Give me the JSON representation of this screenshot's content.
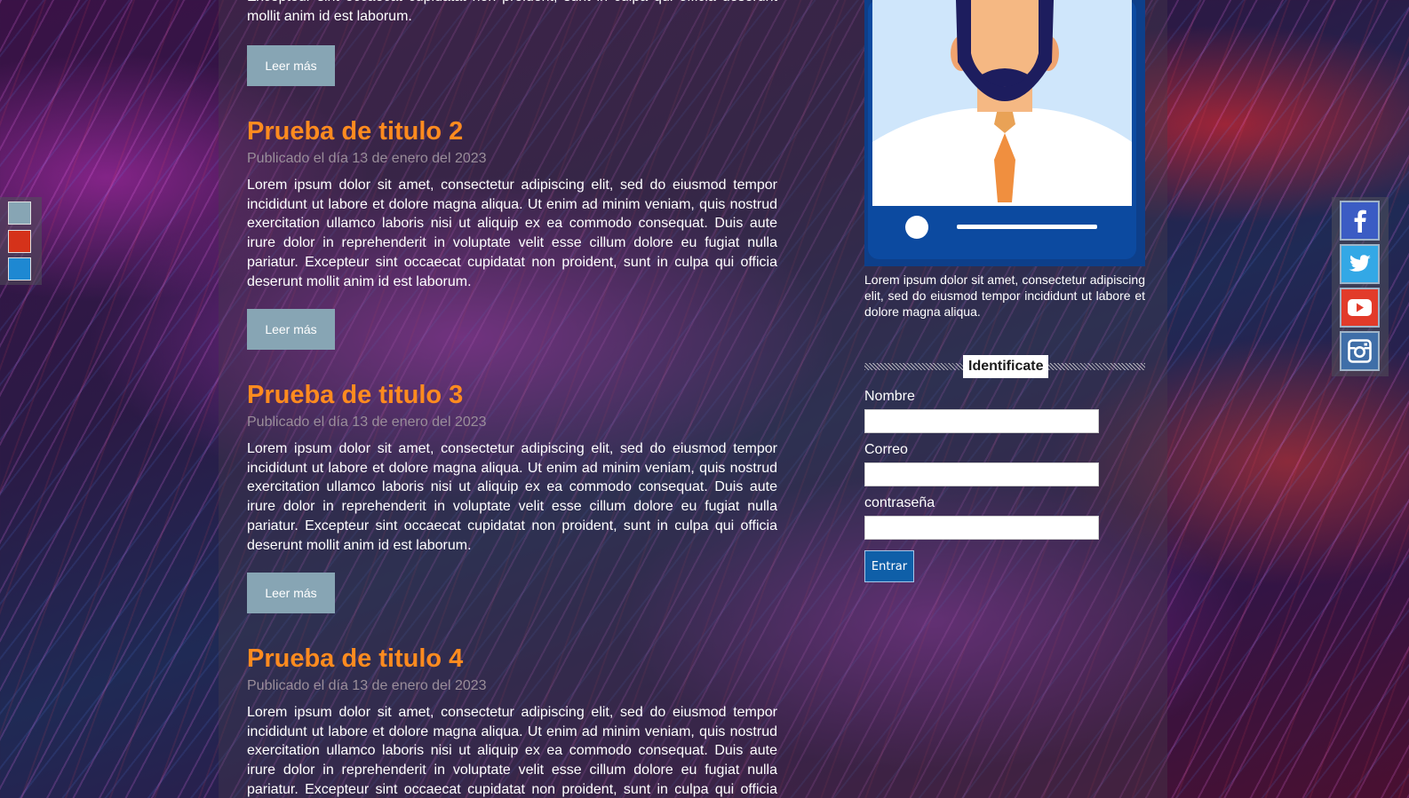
{
  "main": {
    "partial_post": {
      "body": "Excepteur sint occaecat cupidatat non proident, sunt in culpa qui officia deserunt mollit anim id est laborum.",
      "read_more": "Leer más"
    },
    "posts": [
      {
        "title": "Prueba de titulo 2",
        "date": "Publicado el día 13 de enero del 2023",
        "body": "Lorem ipsum dolor sit amet, consectetur adipiscing elit, sed do eiusmod tempor incididunt ut labore et dolore magna aliqua. Ut enim ad minim veniam, quis nostrud exercitation ullamco laboris nisi ut aliquip ex ea commodo consequat. Duis aute irure dolor in reprehenderit in voluptate velit esse cillum dolore eu fugiat nulla pariatur. Excepteur sint occaecat cupidatat non proident, sunt in culpa qui officia deserunt mollit anim id est laborum.",
        "read_more": "Leer más"
      },
      {
        "title": "Prueba de titulo 3",
        "date": "Publicado el día 13 de enero del 2023",
        "body": "Lorem ipsum dolor sit amet, consectetur adipiscing elit, sed do eiusmod tempor incididunt ut labore et dolore magna aliqua. Ut enim ad minim veniam, quis nostrud exercitation ullamco laboris nisi ut aliquip ex ea commodo consequat. Duis aute irure dolor in reprehenderit in voluptate velit esse cillum dolore eu fugiat nulla pariatur. Excepteur sint occaecat cupidatat non proident, sunt in culpa qui officia deserunt mollit anim id est laborum.",
        "read_more": "Leer más"
      },
      {
        "title": "Prueba de titulo 4",
        "date": "Publicado el día 13 de enero del 2023",
        "body": "Lorem ipsum dolor sit amet, consectetur adipiscing elit, sed do eiusmod tempor incididunt ut labore et dolore magna aliqua. Ut enim ad minim veniam, quis nostrud exercitation ullamco laboris nisi ut aliquip ex ea commodo consequat. Duis aute irure dolor in reprehenderit in voluptate velit esse cillum dolore eu fugiat nulla pariatur. Excepteur sint occaecat cupidatat non proident, sunt in culpa qui officia deserunt"
      }
    ]
  },
  "sidebar": {
    "profile_text": "Lorem ipsum dolor sit amet, consectetur adipiscing elit, sed do eiusmod tempor incididunt ut labore et dolore magna aliqua.",
    "login": {
      "heading": "Identificate",
      "name_label": "Nombre",
      "email_label": "Correo",
      "password_label": "contraseña",
      "submit_label": "Entrar"
    }
  },
  "theme_switcher": {
    "swatches": [
      {
        "name": "steel-blue",
        "color": "#87a5b4"
      },
      {
        "name": "red",
        "color": "#d5321a"
      },
      {
        "name": "blue",
        "color": "#1e88d2"
      }
    ]
  },
  "social": [
    {
      "name": "facebook",
      "icon": "facebook-icon",
      "color": "#3b5cc4"
    },
    {
      "name": "twitter",
      "icon": "twitter-icon",
      "color": "#33a8e6"
    },
    {
      "name": "youtube",
      "icon": "youtube-icon",
      "color": "#e23b2a"
    },
    {
      "name": "instagram",
      "icon": "instagram-icon",
      "color": "#3f6ea8"
    }
  ],
  "colors": {
    "title_orange": "#ff8b1f",
    "button_grey_blue": "#87a5b4",
    "submit_blue": "#0f5fa8"
  }
}
